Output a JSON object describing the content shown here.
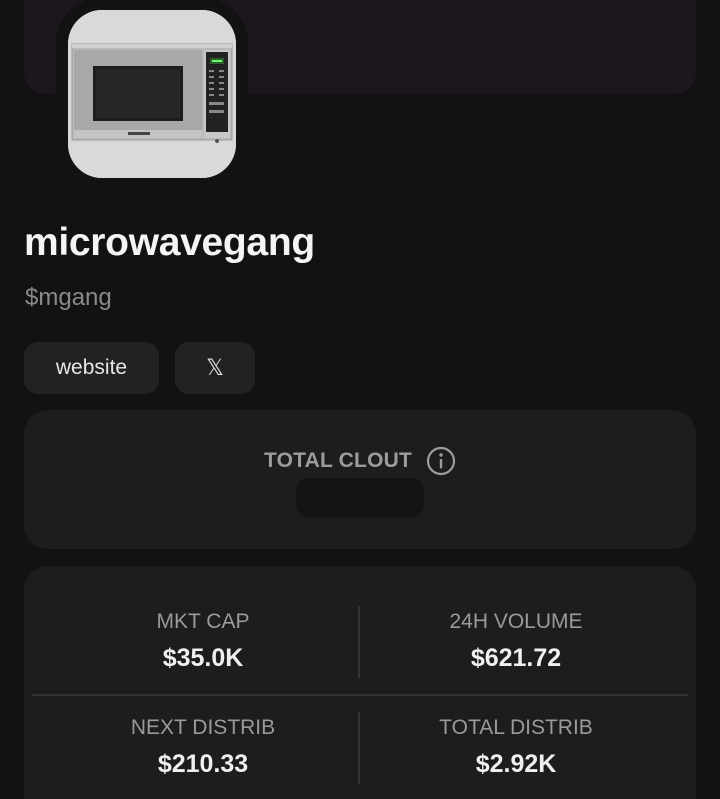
{
  "token": {
    "name": "microwavegang",
    "ticker": "$mgang",
    "image_icon": "microwave-image"
  },
  "links": {
    "website_label": "website",
    "x_label": "𝕏"
  },
  "clout": {
    "label": "TOTAL CLOUT",
    "info_icon": "info-icon"
  },
  "stats": {
    "mkt_cap_label": "MKT CAP",
    "mkt_cap_value": "$35.0K",
    "volume_label": "24H VOLUME",
    "volume_value": "$621.72",
    "next_distrib_label": "NEXT DISTRIB",
    "next_distrib_value": "$210.33",
    "total_distrib_label": "TOTAL DISTRIB",
    "total_distrib_value": "$2.92K"
  },
  "colors": {
    "background": "#121212",
    "banner": "#1d161f",
    "card": "#1d1d1d",
    "button": "#222222"
  }
}
